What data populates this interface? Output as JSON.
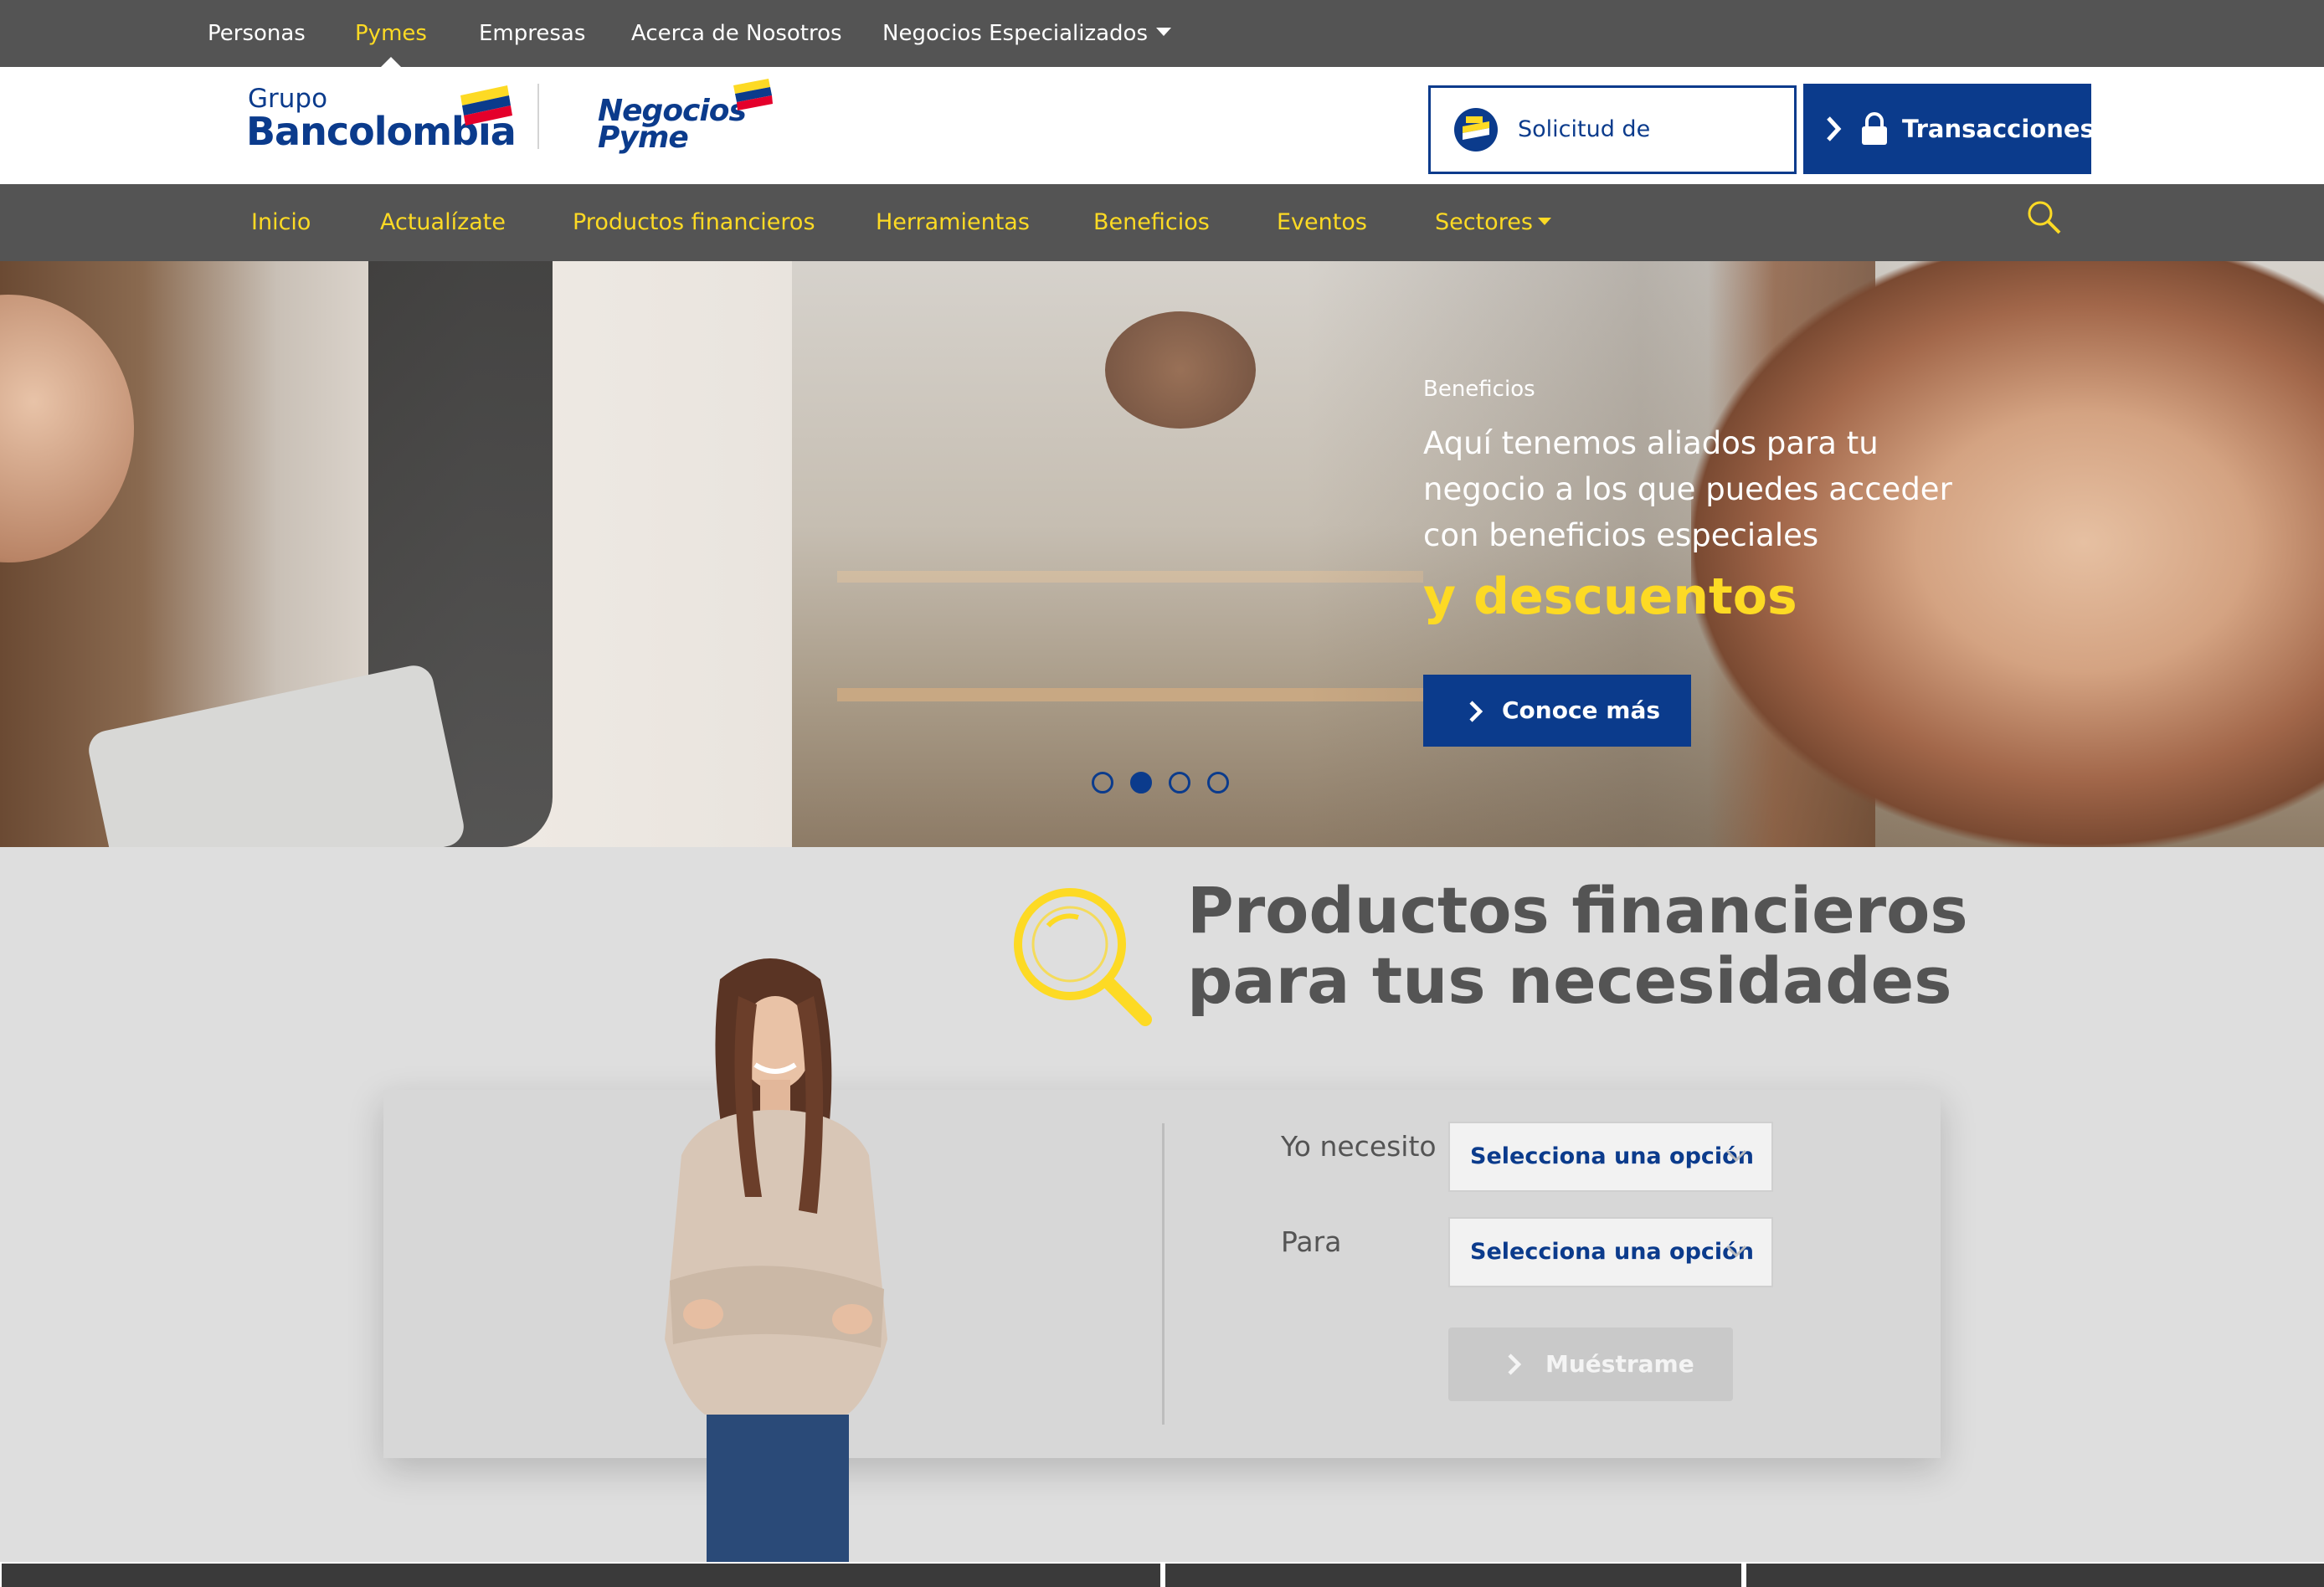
{
  "top_nav": {
    "items": [
      {
        "label": "Personas",
        "active": false
      },
      {
        "label": "Pymes",
        "active": true
      },
      {
        "label": "Empresas",
        "active": false
      },
      {
        "label": "Acerca de Nosotros",
        "active": false
      },
      {
        "label": "Negocios Especializados",
        "active": false,
        "has_dropdown": true
      }
    ]
  },
  "header": {
    "logo_grupo_line1": "Grupo",
    "logo_grupo_line2": "Bancolombia",
    "logo_pyme_line1": "Negocios",
    "logo_pyme_line2": "Pyme",
    "docs_button": "Solicitud de documentos",
    "transactions_button": "Transacciones"
  },
  "main_nav": {
    "items": [
      {
        "label": "Inicio"
      },
      {
        "label": "Actualízate"
      },
      {
        "label": "Productos financieros"
      },
      {
        "label": "Herramientas"
      },
      {
        "label": "Beneficios"
      },
      {
        "label": "Eventos"
      },
      {
        "label": "Sectores",
        "has_dropdown": true
      }
    ],
    "search_icon": "search-icon"
  },
  "hero": {
    "kicker": "Beneficios",
    "headline": "Aquí tenemos aliados para tu negocio a los que puedes acceder con beneficios especiales",
    "accent": "y descuentos",
    "cta": "Conoce más",
    "slides": 4,
    "active_slide": 2
  },
  "products": {
    "title_line1": "Productos financieros",
    "title_line2": "para tus necesidades",
    "need_label": "Yo necesito",
    "need_value": "Selecciona una opción",
    "for_label": "Para",
    "for_value": "Selecciona una opción",
    "show_button": "Muéstrame"
  },
  "colors": {
    "brand_blue": "#0b3b8c",
    "brand_yellow": "#fdda24",
    "bar_gray": "#545454"
  }
}
